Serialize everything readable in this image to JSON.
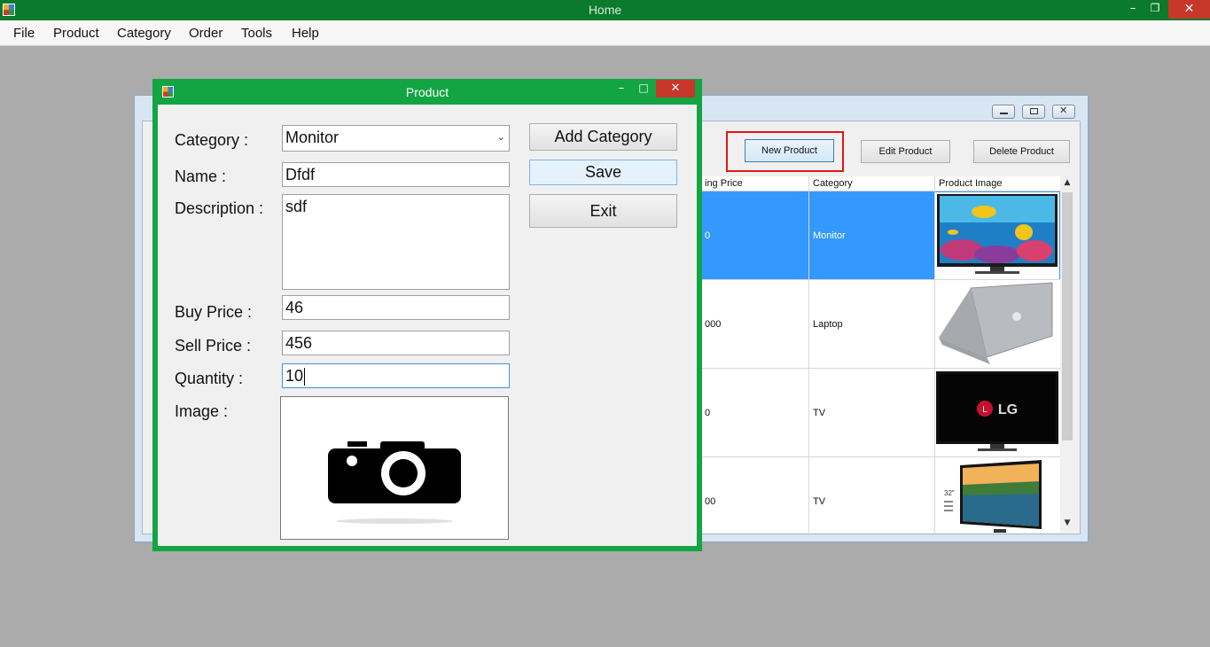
{
  "window": {
    "title": "Home"
  },
  "menu": [
    "File",
    "Product",
    "Category",
    "Order",
    "Tools",
    "Help"
  ],
  "product_list": {
    "buttons": {
      "new": "New Product",
      "edit": "Edit Product",
      "delete": "Delete Product"
    },
    "columns": [
      "ing Price",
      "Category",
      "Product Image"
    ],
    "rows": [
      {
        "price": "0",
        "category": "Monitor",
        "image": "monitor-image",
        "selected": true
      },
      {
        "price": "000",
        "category": "Laptop",
        "image": "laptop-image",
        "selected": false
      },
      {
        "price": "0",
        "category": "TV",
        "image": "lg-tv-image",
        "selected": false
      },
      {
        "price": "00",
        "category": "TV",
        "image": "landscape-tv-image",
        "selected": false
      }
    ],
    "tv_sticker": "32\""
  },
  "dialog": {
    "title": "Product",
    "labels": {
      "category": "Category :",
      "name": "Name :",
      "description": "Description  :",
      "buy_price": "Buy Price :",
      "sell_price": "Sell Price :",
      "quantity": "Quantity :",
      "image": "Image :"
    },
    "values": {
      "category": "Monitor",
      "name": "Dfdf",
      "description": "sdf",
      "buy_price": "46",
      "sell_price": "456",
      "quantity": "10"
    },
    "buttons": {
      "add_category": "Add Category",
      "save": "Save",
      "exit": "Exit"
    },
    "image_placeholder_icon": "camera-icon",
    "lg_logo": "LG"
  },
  "colors": {
    "titlebar": "#0b7a2c",
    "dialog_border": "#13a543",
    "selection": "#3399ff",
    "highlight": "#e01818",
    "close": "#c7372a"
  }
}
